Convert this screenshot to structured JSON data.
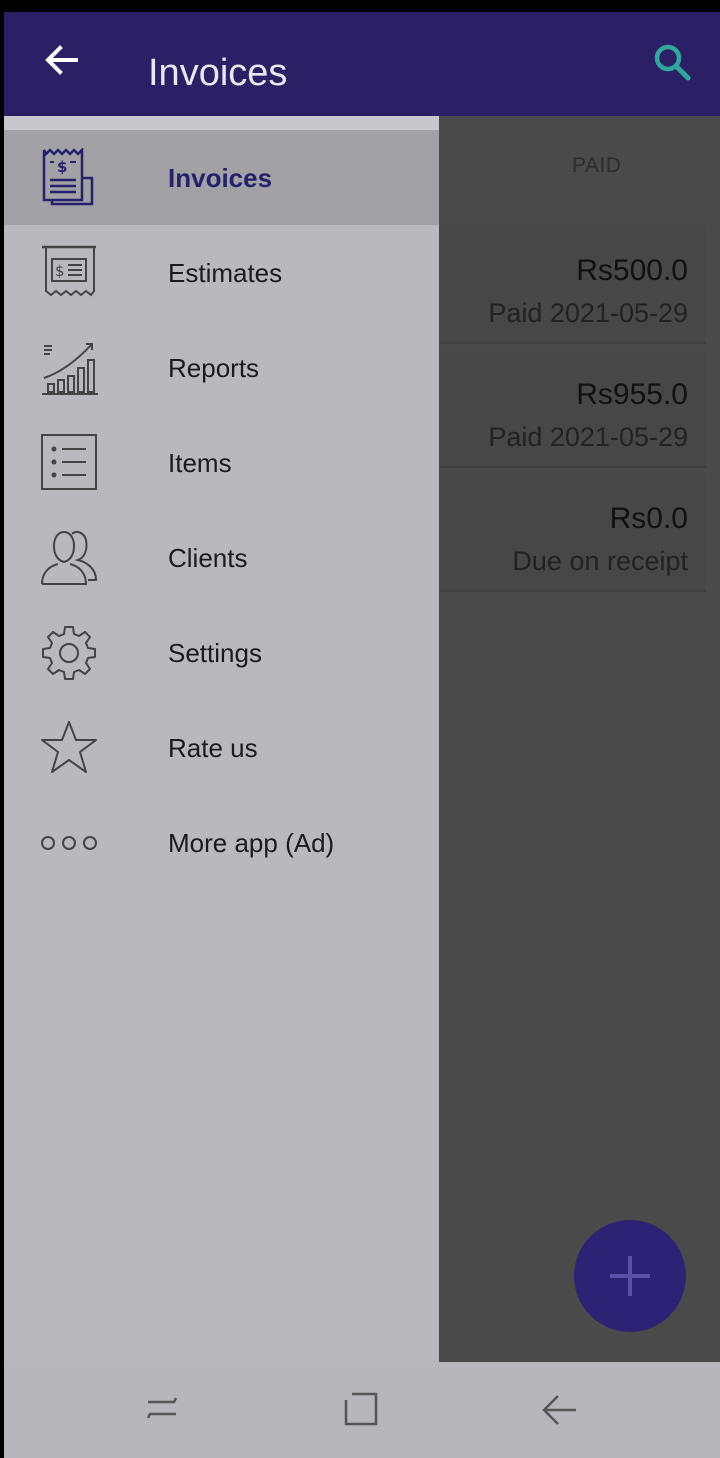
{
  "appbar": {
    "title": "Invoices"
  },
  "content": {
    "tab_label": "PAID",
    "invoices": [
      {
        "amount": "Rs500.0",
        "status": "Paid 2021-05-29"
      },
      {
        "amount": "Rs955.0",
        "status": "Paid 2021-05-29"
      },
      {
        "amount": "Rs0.0",
        "status": "Due on receipt"
      }
    ]
  },
  "drawer": {
    "items": [
      {
        "label": "Invoices",
        "icon": "invoice-icon",
        "active": true
      },
      {
        "label": "Estimates",
        "icon": "estimate-icon"
      },
      {
        "label": "Reports",
        "icon": "chart-icon"
      },
      {
        "label": "Items",
        "icon": "list-icon"
      },
      {
        "label": "Clients",
        "icon": "people-icon"
      },
      {
        "label": "Settings",
        "icon": "gear-icon"
      },
      {
        "label": "Rate us",
        "icon": "star-icon"
      },
      {
        "label": "More app (Ad)",
        "icon": "more-dots-icon"
      }
    ]
  },
  "colors": {
    "appbar": "#2b1f66",
    "accent": "#27206a",
    "drawer": "#b9b8bd",
    "scrim": "#4a4a4a"
  }
}
